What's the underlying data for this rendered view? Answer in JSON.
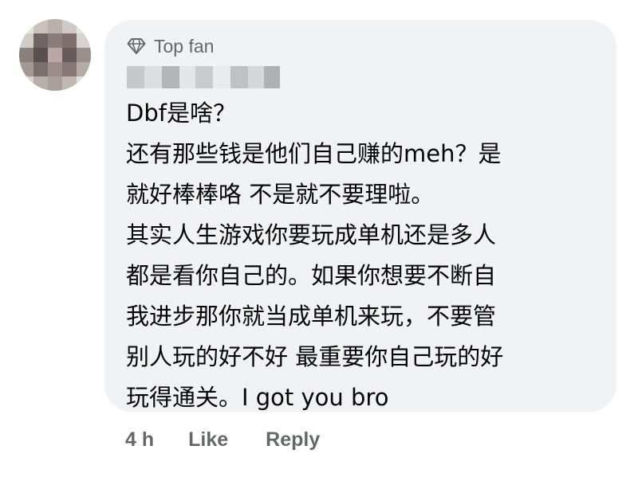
{
  "comment": {
    "author_badge": "Top fan",
    "badge_icon": "diamond-icon",
    "body_lines": [
      "Dbf是啥？",
      "还有那些钱是他们自己赚的meh？是",
      "就好棒棒咯 不是就不要理啦。",
      "其实人生游戏你要玩成单机还是多人",
      "都是看你自己的。如果你想要不断自",
      "我进步那你就当成单机来玩，不要管",
      "别人玩的好不好 最重要你自己玩的好",
      "玩得通关。I got you bro"
    ]
  },
  "actions": {
    "timestamp": "4 h",
    "like_label": "Like",
    "reply_label": "Reply"
  },
  "colors": {
    "bubble_bg": "#f0f2f5",
    "secondary_text": "#65676b",
    "primary_text": "#050505"
  }
}
